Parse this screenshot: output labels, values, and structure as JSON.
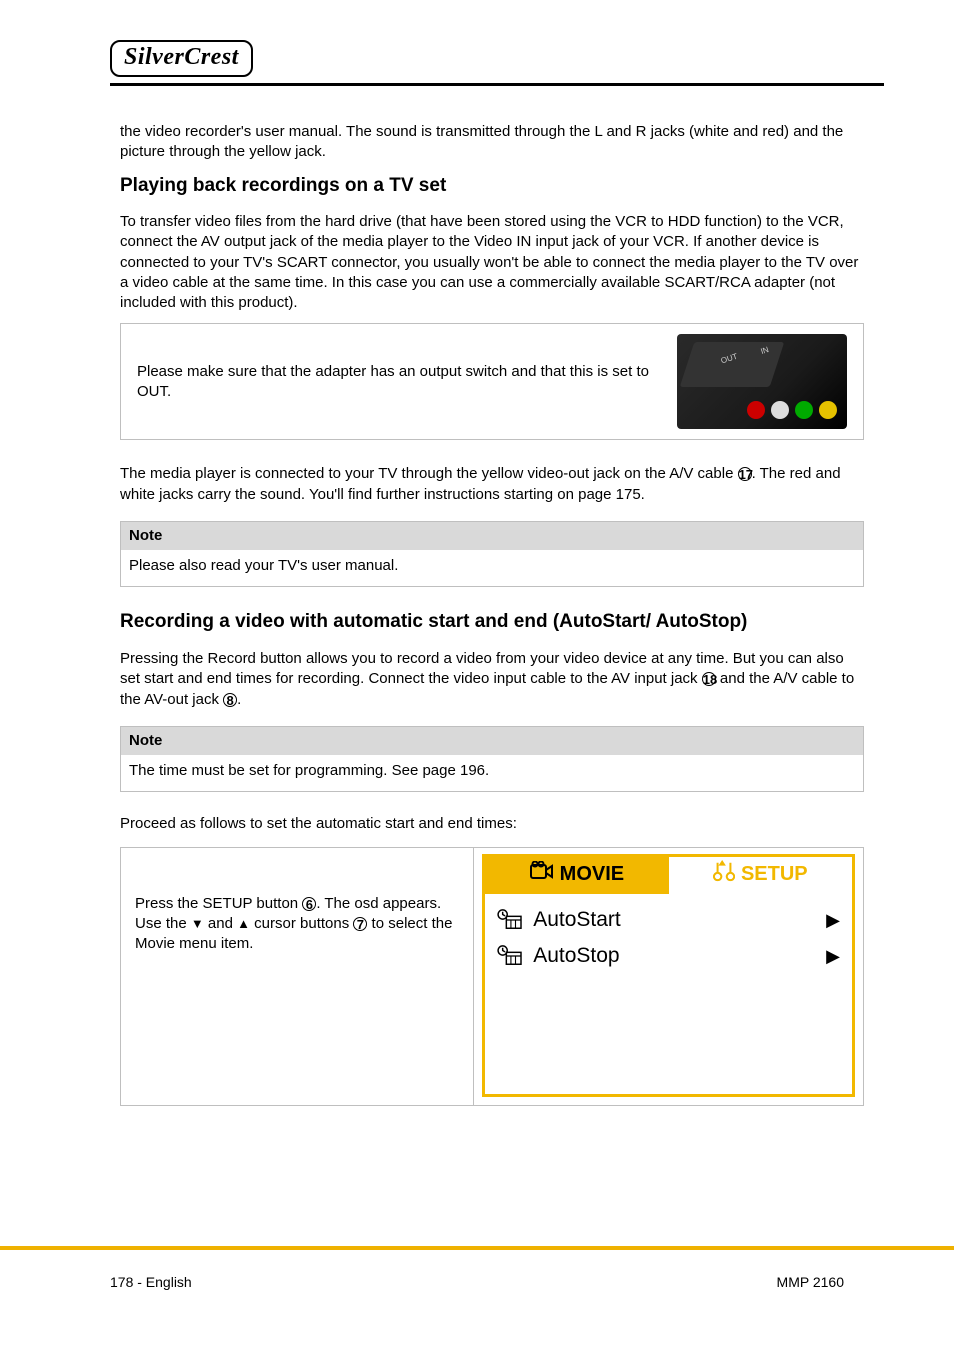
{
  "brand": "SilverCrest",
  "lead_para": "the video recorder's user manual. The sound is transmitted through the L and R jacks (white and red) and the picture through the yellow jack.",
  "sec1_title": "Playing back recordings on a TV set",
  "sec1_p1": "To transfer video files from the hard drive (that have been stored using the VCR to HDD function) to the VCR, connect the AV output jack of the media player to the Video IN input jack of your VCR.  If another device is connected to your TV's SCART connector, you usually won't be able to connect the media player to the TV over a video cable at the same time. In this case you can use a commercially available SCART/RCA adapter (not included with this product).",
  "box1_text": "Please make sure that the adapter has an output switch and that this is set to OUT.",
  "sec1_p2_a": "The media player is connected to your TV through the yellow video-out jack on the A/V cable ",
  "sec1_p2_b": ". The red and white jacks carry the sound. You'll find further instructions starting on page 175.",
  "note1_head": "Note",
  "note1_body": "Please also read your TV's user manual.",
  "sec2_title": "Recording a video with automatic start and end (AutoStart/ AutoStop)",
  "sec2_p1_a": "Pressing the Record button allows you to record a video from your video device at any time. But you can also set start and end times for recording. Connect the video input cable to the AV input jack ",
  "sec2_p1_b": " and the A/V cable to the AV-out jack ",
  "sec2_p1_c": ".",
  "circ_17": "17",
  "circ_18": "18",
  "circ_8": "8",
  "note2_head": "Note",
  "note2_body": "The time must be set for programming. See page 196.",
  "sec2_p2": "Proceed as follows to set the automatic start and end times:",
  "twocol_left_a": "Press the SETUP button ",
  "twocol_left_b": ". The osd appears. Use the ",
  "twocol_left_c": " and ",
  "twocol_left_d": " cursor buttons ",
  "twocol_left_e": " to select the Movie menu item.",
  "circ_6": "6",
  "circ_7": "7",
  "tri_down": "▼",
  "tri_up": "▲",
  "osd": {
    "tab_active": "MOVIE",
    "tab_inactive": "SETUP",
    "items": [
      {
        "label": "AutoStart"
      },
      {
        "label": "AutoStop"
      }
    ]
  },
  "footer_left": "178  -  English",
  "footer_right": "MMP 2160"
}
